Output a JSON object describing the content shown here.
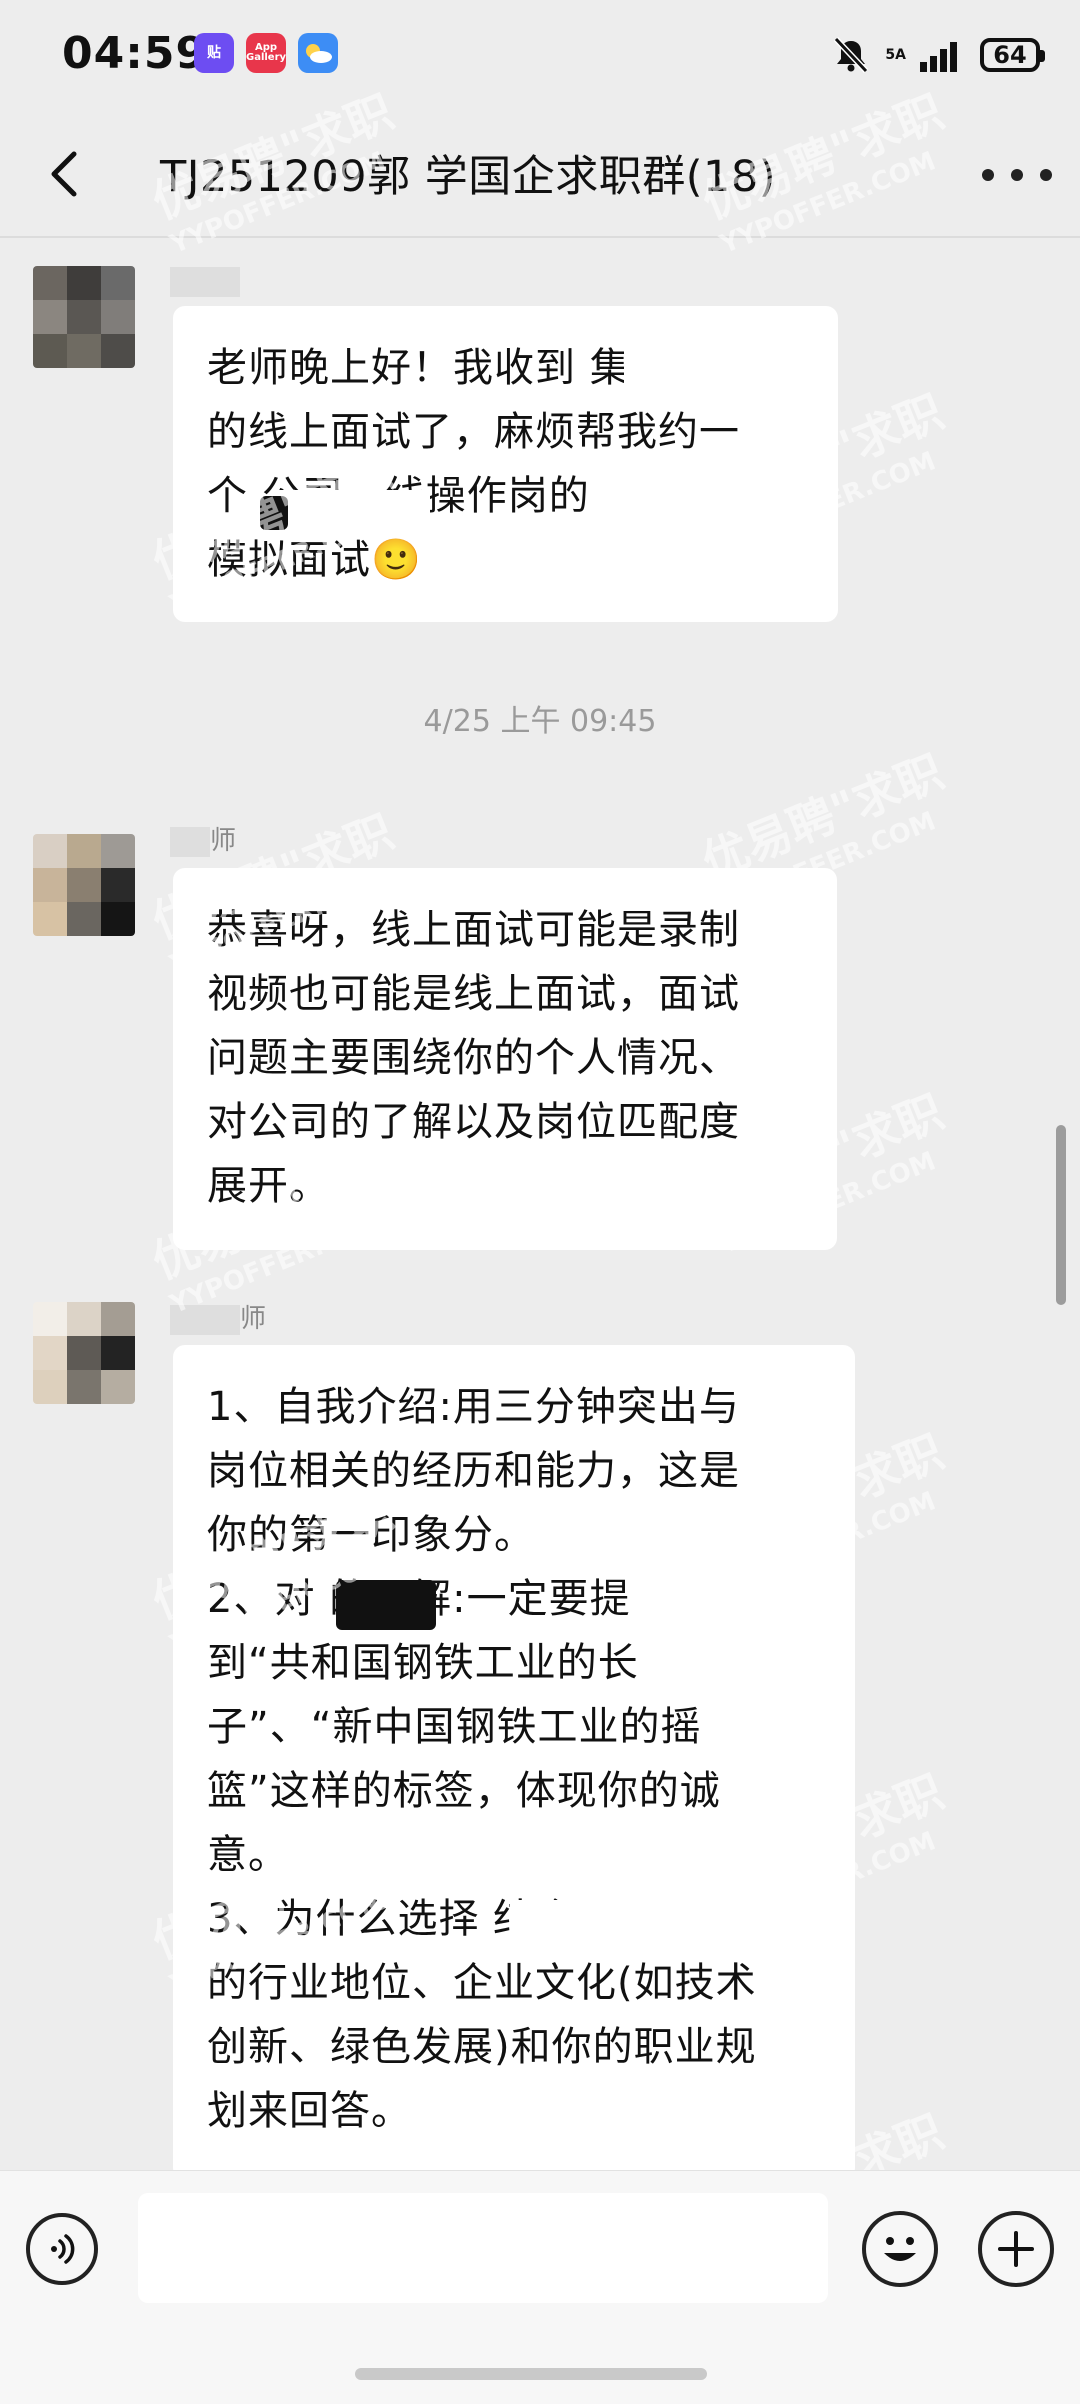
{
  "status_bar": {
    "time": "04:59",
    "apps": [
      {
        "name": "tie-app-icon",
        "label": "贴",
        "color": "#6d4df2"
      },
      {
        "name": "app-gallery-icon",
        "label": "App Gallery",
        "color": "#e8364b"
      },
      {
        "name": "weather-app-icon",
        "label": "",
        "color": "#3d8df5"
      }
    ],
    "network": "5A",
    "battery": "64"
  },
  "header": {
    "title": "TJ251209郭 学国企求职群(18)"
  },
  "watermark": {
    "brand": "优易聘\"求职",
    "domain": "YYPOFFER.COM"
  },
  "messages": [
    {
      "sender": "",
      "text": "老师晚上好！我收到 集团\n的线上面试了，麻烦帮我约一\n个 公司一线操作岗的\n模拟面试🙂"
    },
    {
      "sender": "师",
      "text": "恭喜呀，线上面试可能是录制\n视频也可能是线上面试，面试\n问题主要围绕你的个人情况、\n对公司的了解以及岗位匹配度\n展开。"
    },
    {
      "sender": "师",
      "text": "1、自我介绍:用三分钟突出与\n岗位相关的经历和能力，这是\n你的第一印象分。\n2、对 的了解:一定要提\n到“共和国钢铁工业的长\n子”、“新中国钢铁工业的摇\n篮”这样的标签，体现你的诚\n意。\n3、为什么选择 结合\n的行业地位、企业文化(如技术\n创新、绿色发展)和你的职业规\n划来回答。"
    }
  ],
  "timestamp": "4/25 上午 09:45",
  "input": {
    "value": "",
    "placeholder": ""
  }
}
